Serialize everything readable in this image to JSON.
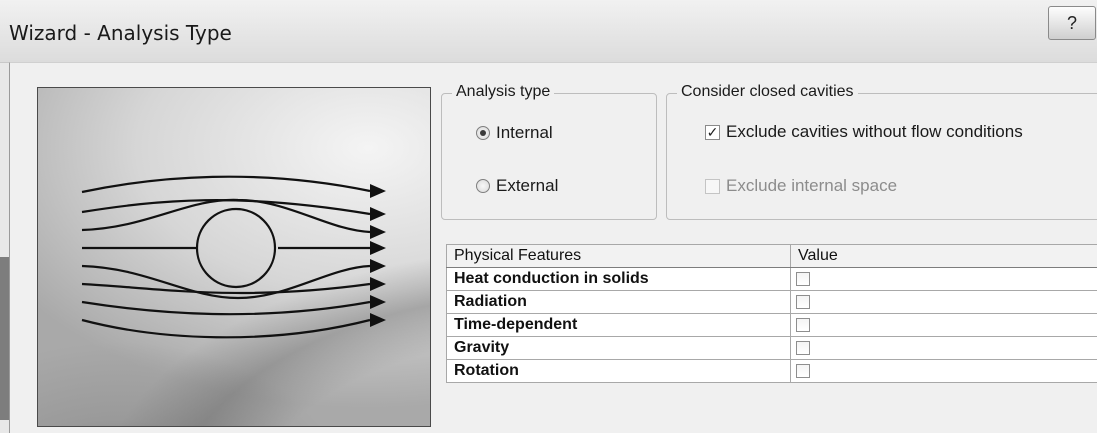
{
  "window": {
    "title": "Wizard - Analysis Type",
    "help_label": "?"
  },
  "analysis_type": {
    "legend": "Analysis type",
    "options": [
      {
        "label": "Internal",
        "selected": true
      },
      {
        "label": "External",
        "selected": false
      }
    ]
  },
  "cavities": {
    "legend": "Consider closed cavities",
    "options": [
      {
        "label": "Exclude cavities without flow conditions",
        "checked": true,
        "enabled": true
      },
      {
        "label": "Exclude internal space",
        "checked": false,
        "enabled": false
      }
    ]
  },
  "features_table": {
    "headers": [
      "Physical Features",
      "Value"
    ],
    "rows": [
      {
        "feature": "Heat conduction in solids",
        "value": false
      },
      {
        "feature": "Radiation",
        "value": false
      },
      {
        "feature": "Time-dependent",
        "value": false
      },
      {
        "feature": "Gravity",
        "value": false
      },
      {
        "feature": "Rotation",
        "value": false
      }
    ]
  },
  "icons": {
    "radio_on": "radio-selected",
    "check_on": "checkmark"
  },
  "colors": {
    "window_bg": "#f0f0f0",
    "title_bg": "#e4e4e4",
    "table_bg": "#ffffff"
  }
}
